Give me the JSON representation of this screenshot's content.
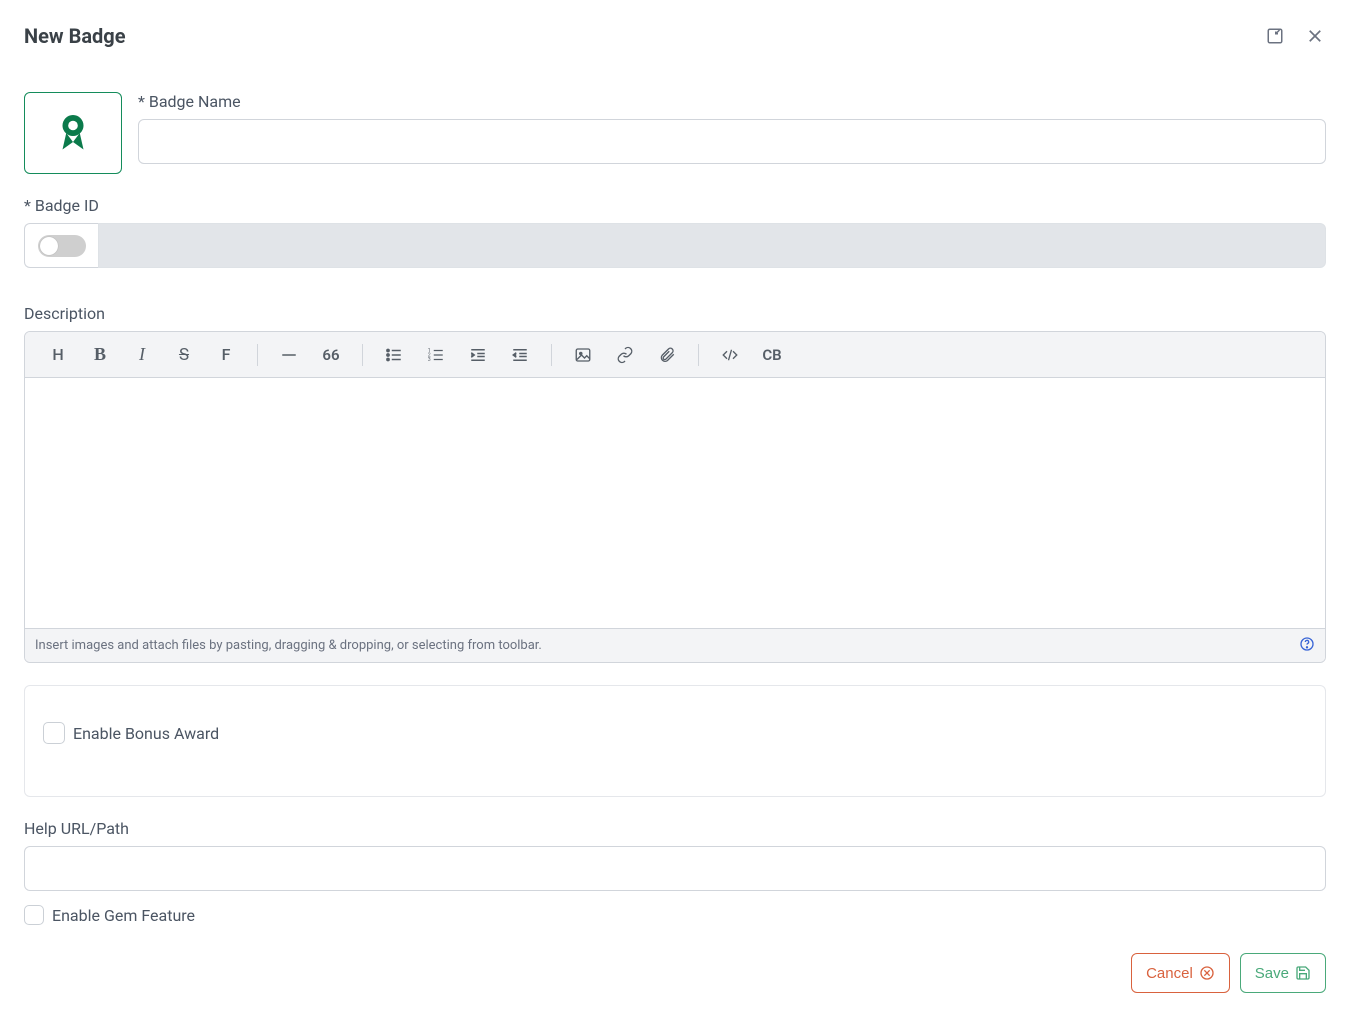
{
  "modal": {
    "title": "New Badge"
  },
  "form": {
    "badgeNameLabel": "* Badge Name",
    "badgeNameValue": "",
    "badgeIdLabel": "* Badge ID",
    "badgeIdValue": "",
    "descriptionLabel": "Description",
    "descriptionValue": "",
    "editorHint": "Insert images and attach files by pasting, dragging & dropping, or selecting from toolbar.",
    "enableBonusLabel": "Enable Bonus Award",
    "helpUrlLabel": "Help URL/Path",
    "helpUrlValue": "",
    "enableGemLabel": "Enable Gem Feature"
  },
  "toolbar": {
    "quote": "66",
    "codeblock": "CB"
  },
  "actions": {
    "cancel": "Cancel",
    "save": "Save"
  }
}
